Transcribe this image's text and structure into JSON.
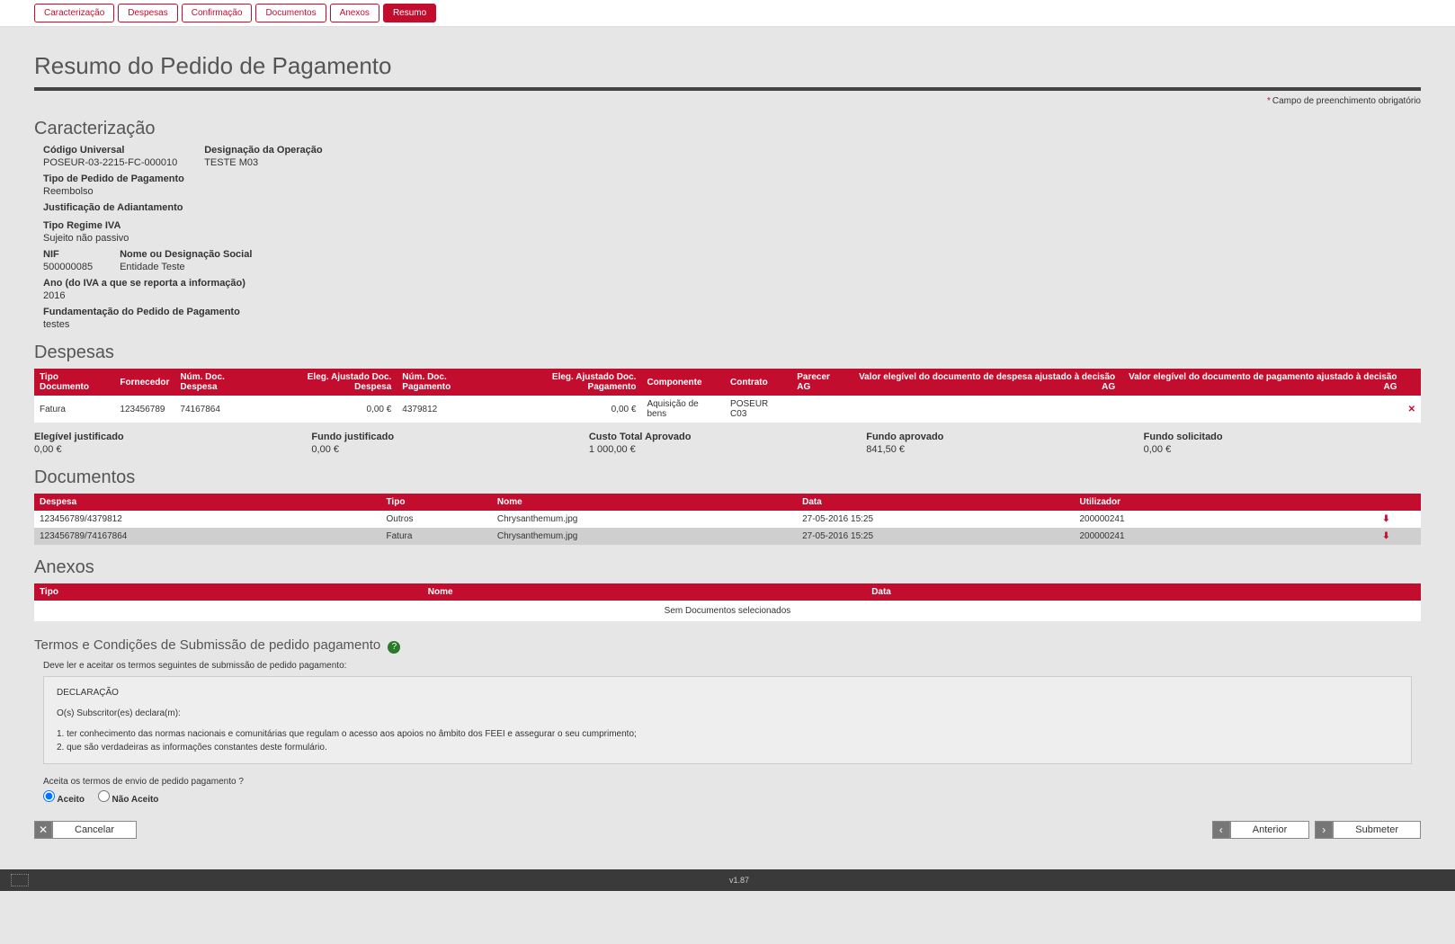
{
  "tabs": [
    "Caracterização",
    "Despesas",
    "Confirmação",
    "Documentos",
    "Anexos",
    "Resumo"
  ],
  "activeTab": 5,
  "pageTitle": "Resumo do Pedido de Pagamento",
  "requiredNote": "Campo de preenchimento obrigatório",
  "sections": {
    "caracterizacao": "Caracterização",
    "despesas": "Despesas",
    "documentos": "Documentos",
    "anexos": "Anexos"
  },
  "carac": {
    "codigoUniversal_lbl": "Código Universal",
    "codigoUniversal": "POSEUR-03-2215-FC-000010",
    "designacao_lbl": "Designação da Operação",
    "designacao": "TESTE M03",
    "tipoPedido_lbl": "Tipo de Pedido de Pagamento",
    "tipoPedido": "Reembolso",
    "justAdiantamento_lbl": "Justificação de Adiantamento",
    "justAdiantamento": "",
    "tipoRegimeIVA_lbl": "Tipo Regime IVA",
    "tipoRegimeIVA": "Sujeito não passivo",
    "nif_lbl": "NIF",
    "nif": "500000085",
    "nomeSocial_lbl": "Nome ou Designação Social",
    "nomeSocial": "Entidade Teste",
    "anoIVA_lbl": "Ano (do IVA a que se reporta a informação)",
    "anoIVA": "2016",
    "fundamentacao_lbl": "Fundamentação do Pedido de Pagamento",
    "fundamentacao": "testes"
  },
  "despesasTable": {
    "headers": [
      "Tipo Documento",
      "Fornecedor",
      "Núm. Doc. Despesa",
      "Eleg. Ajustado Doc. Despesa",
      "Núm. Doc. Pagamento",
      "Eleg. Ajustado Doc. Pagamento",
      "Componente",
      "Contrato",
      "Parecer AG",
      "Valor elegível do documento de despesa ajustado à decisão AG",
      "Valor elegível do documento de pagamento ajustado à decisão AG",
      ""
    ],
    "row": [
      "Fatura",
      "123456789",
      "74167864",
      "0,00 €",
      "4379812",
      "0,00 €",
      "Aquisição de bens",
      "POSEUR C03",
      "",
      "",
      "",
      "✕"
    ]
  },
  "totals": [
    {
      "lbl": "Elegível justificado",
      "val": "0,00 €"
    },
    {
      "lbl": "Fundo justificado",
      "val": "0,00 €"
    },
    {
      "lbl": "Custo Total Aprovado",
      "val": "1 000,00 €"
    },
    {
      "lbl": "Fundo aprovado",
      "val": "841,50 €"
    },
    {
      "lbl": "Fundo solicitado",
      "val": "0,00 €"
    }
  ],
  "docsTable": {
    "headers": [
      "Despesa",
      "Tipo",
      "Nome",
      "Data",
      "Utilizador",
      ""
    ],
    "rows": [
      [
        "123456789/4379812",
        "Outros",
        "Chrysanthemum.jpg",
        "27-05-2016 15:25",
        "200000241",
        "⬇"
      ],
      [
        "123456789/74167864",
        "Fatura",
        "Chrysanthemum.jpg",
        "27-05-2016 15:25",
        "200000241",
        "⬇"
      ]
    ]
  },
  "anexosTable": {
    "headers": [
      "Tipo",
      "Nome",
      "Data"
    ],
    "empty": "Sem Documentos selecionados"
  },
  "terms": {
    "title": "Termos e Condições de Submissão de pedido pagamento",
    "note": "Deve ler e aceitar os termos seguintes de submissão de pedido pagamento:",
    "decl_title": "DECLARAÇÃO",
    "decl_sub": "O(s) Subscritor(es) declara(m):",
    "decl_1": "1. ter conhecimento das normas nacionais e comunitárias que regulam o acesso aos apoios no âmbito dos FEEI e assegurar o seu cumprimento;",
    "decl_2": "2. que são verdadeiras as informações constantes deste formulário.",
    "accept_q": "Aceita os termos de envio de pedido pagamento ?",
    "aceito": "Aceito",
    "naoAceito": "Não Aceito"
  },
  "buttons": {
    "cancelar": "Cancelar",
    "anterior": "Anterior",
    "submeter": "Submeter"
  },
  "footer": {
    "eu1": "",
    "eu2": "",
    "page": "v1.87"
  }
}
